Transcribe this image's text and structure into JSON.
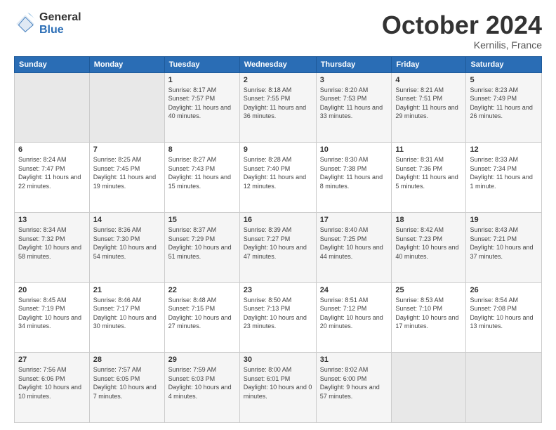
{
  "logo": {
    "general": "General",
    "blue": "Blue"
  },
  "header": {
    "month": "October 2024",
    "location": "Kernilis, France"
  },
  "days_of_week": [
    "Sunday",
    "Monday",
    "Tuesday",
    "Wednesday",
    "Thursday",
    "Friday",
    "Saturday"
  ],
  "weeks": [
    [
      {
        "day": "",
        "info": ""
      },
      {
        "day": "",
        "info": ""
      },
      {
        "day": "1",
        "info": "Sunrise: 8:17 AM\nSunset: 7:57 PM\nDaylight: 11 hours and 40 minutes."
      },
      {
        "day": "2",
        "info": "Sunrise: 8:18 AM\nSunset: 7:55 PM\nDaylight: 11 hours and 36 minutes."
      },
      {
        "day": "3",
        "info": "Sunrise: 8:20 AM\nSunset: 7:53 PM\nDaylight: 11 hours and 33 minutes."
      },
      {
        "day": "4",
        "info": "Sunrise: 8:21 AM\nSunset: 7:51 PM\nDaylight: 11 hours and 29 minutes."
      },
      {
        "day": "5",
        "info": "Sunrise: 8:23 AM\nSunset: 7:49 PM\nDaylight: 11 hours and 26 minutes."
      }
    ],
    [
      {
        "day": "6",
        "info": "Sunrise: 8:24 AM\nSunset: 7:47 PM\nDaylight: 11 hours and 22 minutes."
      },
      {
        "day": "7",
        "info": "Sunrise: 8:25 AM\nSunset: 7:45 PM\nDaylight: 11 hours and 19 minutes."
      },
      {
        "day": "8",
        "info": "Sunrise: 8:27 AM\nSunset: 7:43 PM\nDaylight: 11 hours and 15 minutes."
      },
      {
        "day": "9",
        "info": "Sunrise: 8:28 AM\nSunset: 7:40 PM\nDaylight: 11 hours and 12 minutes."
      },
      {
        "day": "10",
        "info": "Sunrise: 8:30 AM\nSunset: 7:38 PM\nDaylight: 11 hours and 8 minutes."
      },
      {
        "day": "11",
        "info": "Sunrise: 8:31 AM\nSunset: 7:36 PM\nDaylight: 11 hours and 5 minutes."
      },
      {
        "day": "12",
        "info": "Sunrise: 8:33 AM\nSunset: 7:34 PM\nDaylight: 11 hours and 1 minute."
      }
    ],
    [
      {
        "day": "13",
        "info": "Sunrise: 8:34 AM\nSunset: 7:32 PM\nDaylight: 10 hours and 58 minutes."
      },
      {
        "day": "14",
        "info": "Sunrise: 8:36 AM\nSunset: 7:30 PM\nDaylight: 10 hours and 54 minutes."
      },
      {
        "day": "15",
        "info": "Sunrise: 8:37 AM\nSunset: 7:29 PM\nDaylight: 10 hours and 51 minutes."
      },
      {
        "day": "16",
        "info": "Sunrise: 8:39 AM\nSunset: 7:27 PM\nDaylight: 10 hours and 47 minutes."
      },
      {
        "day": "17",
        "info": "Sunrise: 8:40 AM\nSunset: 7:25 PM\nDaylight: 10 hours and 44 minutes."
      },
      {
        "day": "18",
        "info": "Sunrise: 8:42 AM\nSunset: 7:23 PM\nDaylight: 10 hours and 40 minutes."
      },
      {
        "day": "19",
        "info": "Sunrise: 8:43 AM\nSunset: 7:21 PM\nDaylight: 10 hours and 37 minutes."
      }
    ],
    [
      {
        "day": "20",
        "info": "Sunrise: 8:45 AM\nSunset: 7:19 PM\nDaylight: 10 hours and 34 minutes."
      },
      {
        "day": "21",
        "info": "Sunrise: 8:46 AM\nSunset: 7:17 PM\nDaylight: 10 hours and 30 minutes."
      },
      {
        "day": "22",
        "info": "Sunrise: 8:48 AM\nSunset: 7:15 PM\nDaylight: 10 hours and 27 minutes."
      },
      {
        "day": "23",
        "info": "Sunrise: 8:50 AM\nSunset: 7:13 PM\nDaylight: 10 hours and 23 minutes."
      },
      {
        "day": "24",
        "info": "Sunrise: 8:51 AM\nSunset: 7:12 PM\nDaylight: 10 hours and 20 minutes."
      },
      {
        "day": "25",
        "info": "Sunrise: 8:53 AM\nSunset: 7:10 PM\nDaylight: 10 hours and 17 minutes."
      },
      {
        "day": "26",
        "info": "Sunrise: 8:54 AM\nSunset: 7:08 PM\nDaylight: 10 hours and 13 minutes."
      }
    ],
    [
      {
        "day": "27",
        "info": "Sunrise: 7:56 AM\nSunset: 6:06 PM\nDaylight: 10 hours and 10 minutes."
      },
      {
        "day": "28",
        "info": "Sunrise: 7:57 AM\nSunset: 6:05 PM\nDaylight: 10 hours and 7 minutes."
      },
      {
        "day": "29",
        "info": "Sunrise: 7:59 AM\nSunset: 6:03 PM\nDaylight: 10 hours and 4 minutes."
      },
      {
        "day": "30",
        "info": "Sunrise: 8:00 AM\nSunset: 6:01 PM\nDaylight: 10 hours and 0 minutes."
      },
      {
        "day": "31",
        "info": "Sunrise: 8:02 AM\nSunset: 6:00 PM\nDaylight: 9 hours and 57 minutes."
      },
      {
        "day": "",
        "info": ""
      },
      {
        "day": "",
        "info": ""
      }
    ]
  ]
}
